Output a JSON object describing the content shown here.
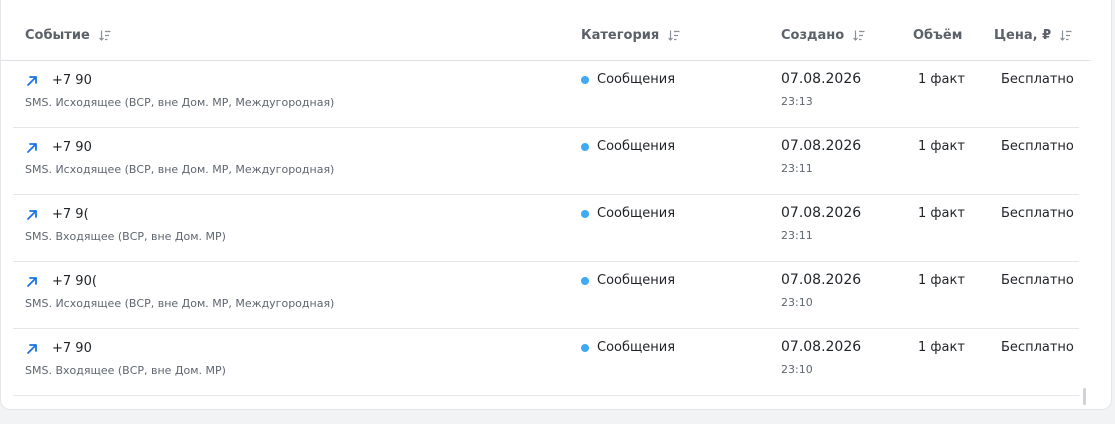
{
  "columns": {
    "event": "Событие",
    "category": "Категория",
    "created": "Создано",
    "volume": "Объём",
    "price": "Цена, ₽"
  },
  "rows": [
    {
      "phone": "+7 90",
      "description": "SMS. Исходящее (ВСР, вне Дом. МР, Междугородная)",
      "category": "Сообщения",
      "date": "07.08.2026",
      "time": "23:13",
      "volume": "1 факт",
      "price": "Бесплатно"
    },
    {
      "phone": "+7 90",
      "description": "SMS. Исходящее (ВСР, вне Дом. МР, Междугородная)",
      "category": "Сообщения",
      "date": "07.08.2026",
      "time": "23:11",
      "volume": "1 факт",
      "price": "Бесплатно"
    },
    {
      "phone": "+7 9(",
      "description": "SMS. Входящее (ВСР, вне Дом. МР)",
      "category": "Сообщения",
      "date": "07.08.2026",
      "time": "23:11",
      "volume": "1 факт",
      "price": "Бесплатно"
    },
    {
      "phone": "+7 90(",
      "description": "SMS. Исходящее (ВСР, вне Дом. МР, Междугородная)",
      "category": "Сообщения",
      "date": "07.08.2026",
      "time": "23:10",
      "volume": "1 факт",
      "price": "Бесплатно"
    },
    {
      "phone": "+7 90",
      "description": "SMS. Входящее (ВСР, вне Дом. МР)",
      "category": "Сообщения",
      "date": "07.08.2026",
      "time": "23:10",
      "volume": "1 факт",
      "price": "Бесплатно"
    }
  ],
  "colors": {
    "accent": "#1a73e8",
    "category_dot": "#3fa9f5"
  },
  "icons": {
    "sort": "sort-icon",
    "direction": "arrow-up-right-icon"
  }
}
